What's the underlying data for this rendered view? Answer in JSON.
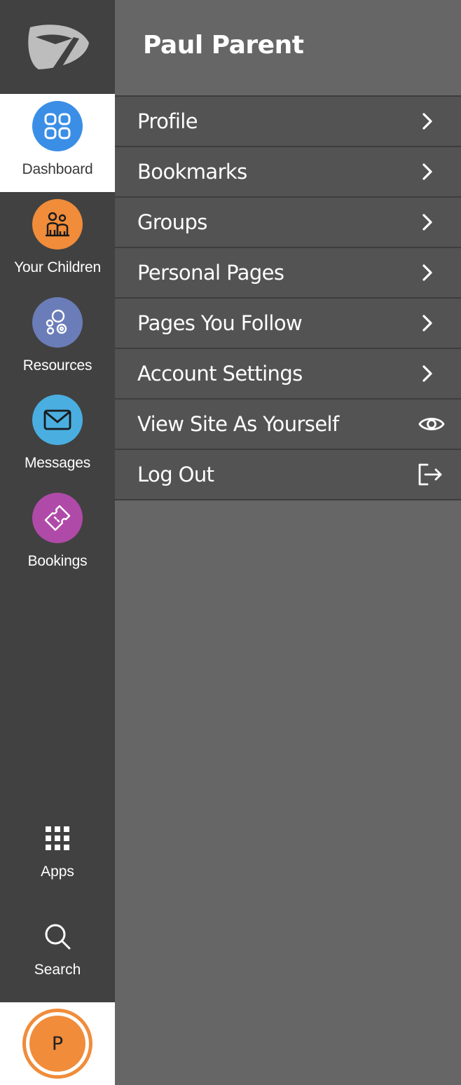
{
  "rail": {
    "nav": [
      {
        "label": "Dashboard",
        "icon": "dashboard-grid-icon",
        "color": "#3a8ee6",
        "active": true
      },
      {
        "label": "Your Children",
        "icon": "children-icon",
        "color": "#f08c3a",
        "active": false
      },
      {
        "label": "Resources",
        "icon": "resources-icon",
        "color": "#6b7db8",
        "active": false
      },
      {
        "label": "Messages",
        "icon": "envelope-icon",
        "color": "#4aaee0",
        "active": false
      },
      {
        "label": "Bookings",
        "icon": "ticket-icon",
        "color": "#b04aa8",
        "active": false
      }
    ],
    "tools": [
      {
        "label": "Apps",
        "icon": "apps-grid-icon"
      },
      {
        "label": "Search",
        "icon": "search-icon"
      }
    ],
    "avatar_initial": "P",
    "avatar_color": "#f08c3a"
  },
  "panel": {
    "user_name": "Paul Parent",
    "menu": [
      {
        "label": "Profile",
        "icon": "chevron-right-icon"
      },
      {
        "label": "Bookmarks",
        "icon": "chevron-right-icon"
      },
      {
        "label": "Groups",
        "icon": "chevron-right-icon"
      },
      {
        "label": "Personal Pages",
        "icon": "chevron-right-icon"
      },
      {
        "label": "Pages You Follow",
        "icon": "chevron-right-icon"
      },
      {
        "label": "Account Settings",
        "icon": "chevron-right-icon"
      },
      {
        "label": "View Site As Yourself",
        "icon": "eye-icon"
      },
      {
        "label": "Log Out",
        "icon": "logout-icon"
      }
    ]
  }
}
